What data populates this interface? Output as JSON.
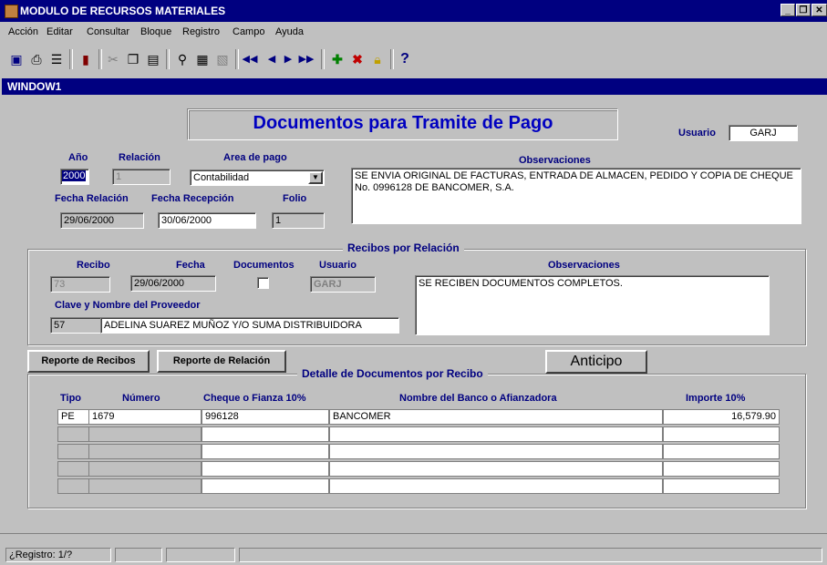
{
  "window": {
    "title": "MODULO DE RECURSOS MATERIALES",
    "min": "_",
    "max": "❐",
    "close": "✕"
  },
  "menu": [
    "Acción",
    "Editar",
    "Consultar",
    "Bloque",
    "Registro",
    "Campo",
    "Ayuda"
  ],
  "toolbar": {
    "help": "?"
  },
  "inner_window": {
    "title": "WINDOW1"
  },
  "form": {
    "heading": "Documentos para Tramite de Pago",
    "usuario_label": "Usuario",
    "usuario_value": "GARJ",
    "anio_label": "Año",
    "anio_value": "2000",
    "relacion_label": "Relación",
    "relacion_value": "1",
    "area_label": "Area de pago",
    "area_value": "Contabilidad",
    "obs_label": "Observaciones",
    "obs_value": "SE ENVIA ORIGINAL DE FACTURAS, ENTRADA DE ALMACEN, PEDIDO Y COPIA DE CHEQUE No. 0996128 DE BANCOMER, S.A.",
    "fecha_rel_label": "Fecha Relación",
    "fecha_rel_value": "29/06/2000",
    "fecha_rec_label": "Fecha Recepción",
    "fecha_rec_value": "30/06/2000",
    "folio_label": "Folio",
    "folio_value": "1"
  },
  "recibos": {
    "title": "Recibos por Relación",
    "recibo_label": "Recibo",
    "recibo_value": "73",
    "fecha_label": "Fecha",
    "fecha_value": "29/06/2000",
    "documentos_label": "Documentos",
    "usuario_label": "Usuario",
    "usuario_value": "GARJ",
    "obs_label": "Observaciones",
    "obs_value": "SE RECIBEN DOCUMENTOS COMPLETOS.",
    "proveedor_label": "Clave y Nombre del Proveedor",
    "proveedor_clave": "57",
    "proveedor_nombre": "ADELINA SUAREZ MUÑOZ Y/O SUMA DISTRIBUIDORA"
  },
  "buttons": {
    "reporte_recibos": "Reporte de Recibos",
    "reporte_relacion": "Reporte de Relación",
    "anticipo": "Anticipo"
  },
  "detalle": {
    "title": "Detalle de Documentos por Recibo",
    "columns": [
      "Tipo",
      "Número",
      "Cheque o Fianza 10%",
      "Nombre del Banco o Afianzadora",
      "Importe 10%"
    ],
    "rows": [
      [
        "PE",
        "1679",
        "996128",
        "BANCOMER",
        "16,579.90"
      ],
      [
        "",
        "",
        "",
        "",
        ""
      ],
      [
        "",
        "",
        "",
        "",
        ""
      ],
      [
        "",
        "",
        "",
        "",
        ""
      ],
      [
        "",
        "",
        "",
        "",
        ""
      ]
    ]
  },
  "status": {
    "registro": "¿Registro: 1/?"
  }
}
